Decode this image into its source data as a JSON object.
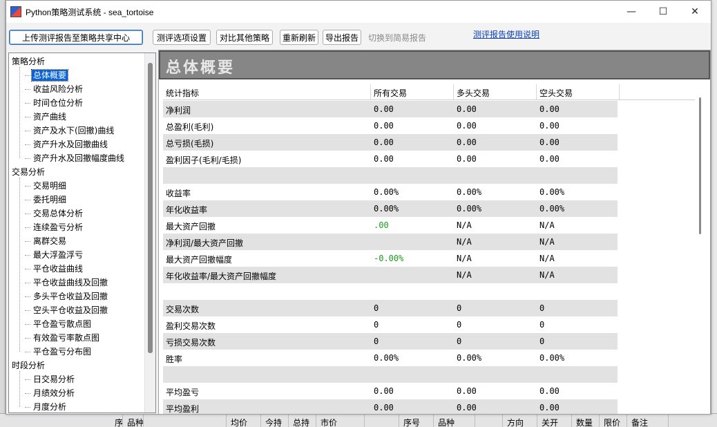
{
  "window": {
    "title": "Python策略测试系统 - sea_tortoise",
    "controls": {
      "minimize": "—",
      "maximize": "☐",
      "close": "✕"
    }
  },
  "toolbar": {
    "upload_label": "上传测评报告至策略共享中心",
    "options_label": "测评选项设置",
    "compare_label": "对比其他策略",
    "refresh_label": "重新刷新",
    "export_label": "导出报告",
    "simple_label": "切换到简易报告",
    "help_link": "测评报告使用说明"
  },
  "tree": {
    "groups": [
      {
        "label": "策略分析",
        "items": [
          "总体概要",
          "收益风险分析",
          "时间仓位分析",
          "资产曲线",
          "资产及水下(回撤)曲线",
          "资产升水及回撤曲线",
          "资产升水及回撤幅度曲线"
        ]
      },
      {
        "label": "交易分析",
        "items": [
          "交易明细",
          "委托明细",
          "交易总体分析",
          "连续盈亏分析",
          "离群交易",
          "最大浮盈浮亏",
          "平仓收益曲线",
          "平仓收益曲线及回撤",
          "多头平仓收益及回撤",
          "空头平仓收益及回撤",
          "平仓盈亏散点图",
          "有效盈亏率散点图",
          "平仓盈亏分布图"
        ]
      },
      {
        "label": "时段分析",
        "items": [
          "日交易分析",
          "月绩效分析",
          "月度分析"
        ]
      }
    ],
    "selected": "总体概要"
  },
  "content": {
    "section_title": "总体概要",
    "headers": [
      "统计指标",
      "所有交易",
      "多头交易",
      "空头交易"
    ],
    "rows": [
      {
        "label": "净利润",
        "all": "0.00",
        "long": "0.00",
        "short": "0.00"
      },
      {
        "label": "总盈利(毛利)",
        "all": "0.00",
        "long": "0.00",
        "short": "0.00"
      },
      {
        "label": "总亏损(毛损)",
        "all": "0.00",
        "long": "0.00",
        "short": "0.00"
      },
      {
        "label": "盈利因子(毛利/毛损)",
        "all": "0.00",
        "long": "0.00",
        "short": "0.00"
      },
      {
        "label": "",
        "all": "",
        "long": "",
        "short": ""
      },
      {
        "label": "收益率",
        "all": "0.00%",
        "long": "0.00%",
        "short": "0.00%"
      },
      {
        "label": "年化收益率",
        "all": "0.00%",
        "long": "0.00%",
        "short": "0.00%"
      },
      {
        "label": "最大资产回撤",
        "all": ".00",
        "long": "N/A",
        "short": "N/A",
        "all_green": true
      },
      {
        "label": "净利润/最大资产回撤",
        "all": "",
        "long": "N/A",
        "short": "N/A"
      },
      {
        "label": "最大资产回撤幅度",
        "all": "-0.00%",
        "long": "N/A",
        "short": "N/A",
        "all_green": true
      },
      {
        "label": "年化收益率/最大资产回撤幅度",
        "all": "",
        "long": "N/A",
        "short": "N/A"
      },
      {
        "label": "",
        "all": "",
        "long": "",
        "short": ""
      },
      {
        "label": "交易次数",
        "all": "0",
        "long": "0",
        "short": "0"
      },
      {
        "label": "盈利交易次数",
        "all": "0",
        "long": "0",
        "short": "0"
      },
      {
        "label": "亏损交易次数",
        "all": "0",
        "long": "0",
        "short": "0"
      },
      {
        "label": "胜率",
        "all": "0.00%",
        "long": "0.00%",
        "short": "0.00%"
      },
      {
        "label": "",
        "all": "",
        "long": "",
        "short": ""
      },
      {
        "label": "平均盈亏",
        "all": "0.00",
        "long": "0.00",
        "short": "0.00"
      },
      {
        "label": "平均盈利",
        "all": "0.00",
        "long": "0.00",
        "short": "0.00"
      }
    ]
  },
  "background": {
    "bottom_columns": [
      "序",
      "品种",
      "",
      "均价",
      "今持",
      "总持",
      "市价",
      "",
      "序号",
      "品种",
      "",
      "方向",
      "关开",
      "数量",
      "限价",
      "备注"
    ]
  },
  "colors": {
    "accent": "#0a64d8",
    "positive": "#1c9a1c",
    "header_bar": "#868686",
    "row_alt": "#e2e2e2"
  }
}
